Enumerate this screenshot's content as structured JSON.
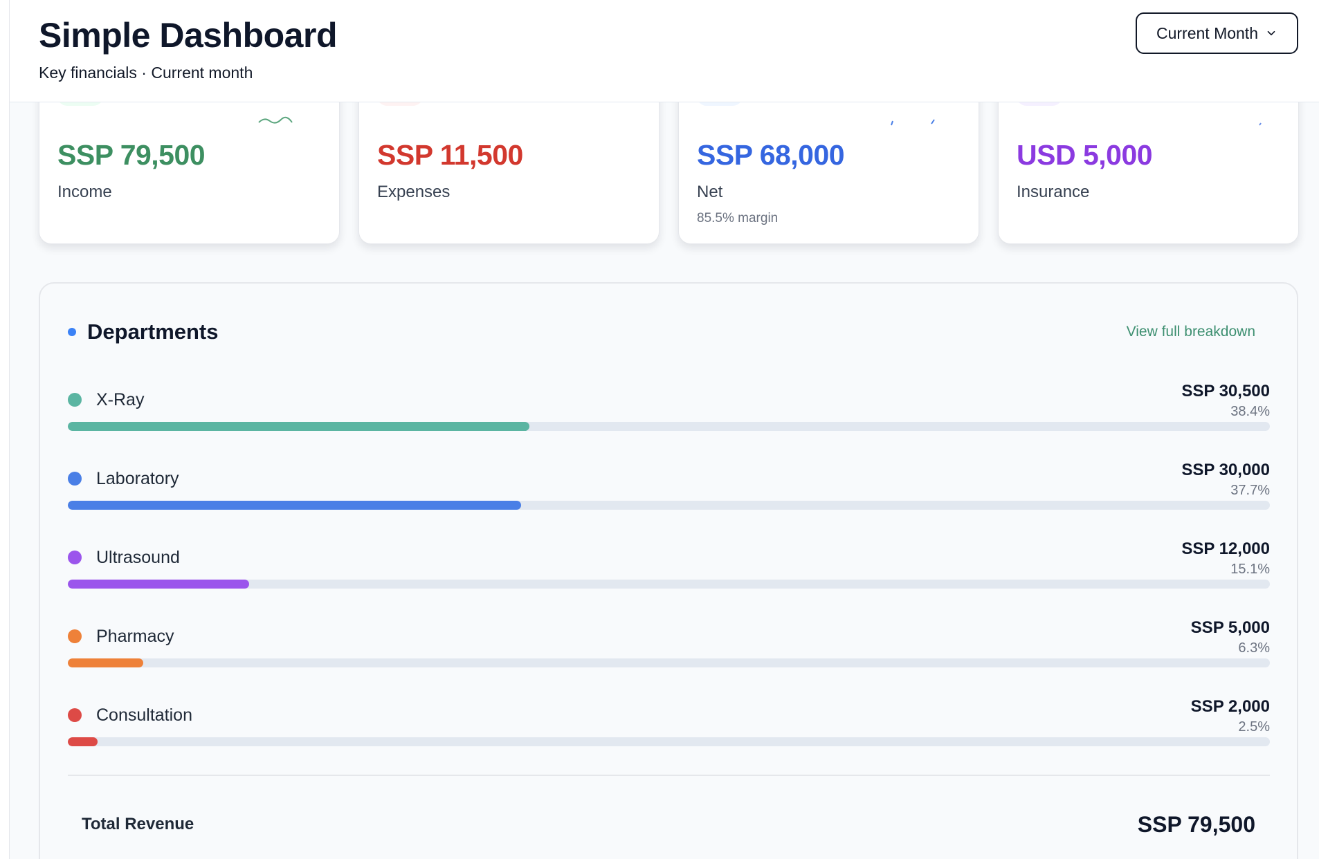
{
  "header": {
    "title": "Simple Dashboard",
    "subtitle": "Key financials · Current month",
    "period_select": {
      "value": "Current Month",
      "icon": "chevron-down-icon"
    }
  },
  "cards": [
    {
      "key": "income",
      "value": "SSP 79,500",
      "label": "Income",
      "sub": "",
      "color": "#3d8f61",
      "chip": "#ecfdf3"
    },
    {
      "key": "expenses",
      "value": "SSP 11,500",
      "label": "Expenses",
      "sub": "",
      "color": "#d2382e",
      "chip": "#fef2f2"
    },
    {
      "key": "net",
      "value": "SSP 68,000",
      "label": "Net",
      "sub": "85.5% margin",
      "color": "#3566e0",
      "chip": "#eff6ff"
    },
    {
      "key": "insurance",
      "value": "USD 5,000",
      "label": "Insurance",
      "sub": "",
      "color": "#8b3ae0",
      "chip": "#f5f0ff"
    }
  ],
  "departments": {
    "title": "Departments",
    "link": "View full breakdown",
    "items": [
      {
        "name": "X-Ray",
        "amount": "SSP 30,500",
        "pct_label": "38.4%",
        "share": 38.4,
        "color": "#5bb5a2"
      },
      {
        "name": "Laboratory",
        "amount": "SSP 30,000",
        "pct_label": "37.7%",
        "share": 37.7,
        "color": "#4a7fe6"
      },
      {
        "name": "Ultrasound",
        "amount": "SSP 12,000",
        "pct_label": "15.1%",
        "share": 15.1,
        "color": "#9b55ec"
      },
      {
        "name": "Pharmacy",
        "amount": "SSP 5,000",
        "pct_label": "6.3%",
        "share": 6.3,
        "color": "#ee8139"
      },
      {
        "name": "Consultation",
        "amount": "SSP 2,000",
        "pct_label": "2.5%",
        "share": 2.5,
        "color": "#dd4a46"
      }
    ],
    "total_label": "Total Revenue",
    "total_value": "SSP 79,500"
  }
}
